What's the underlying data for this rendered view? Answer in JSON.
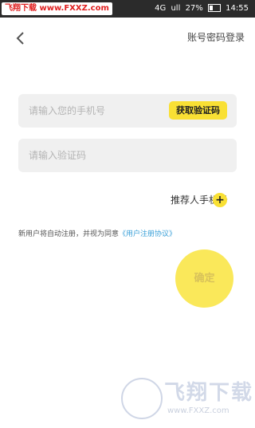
{
  "status_bar": {
    "watermark_text": "飞翔下载 www.FXXZ.com",
    "battery_percent": "27%",
    "time": "14:55",
    "signal_text": "4G",
    "network_text": "ull"
  },
  "header": {
    "back_icon": "chevron-left-icon",
    "title": "账号密码登录"
  },
  "form": {
    "phone_placeholder": "请输入您的手机号",
    "get_code_label": "获取验证码",
    "code_placeholder": "请输入验证码"
  },
  "referrer": {
    "label": "推荐人手机号",
    "add_symbol": "+"
  },
  "agreement": {
    "text": "新用户将自动注册，并视为同意",
    "link": "《用户注册协议》"
  },
  "confirm": {
    "label": "确定"
  },
  "watermark": {
    "brand": "飞翔下载",
    "url": "www.FXXZ.com"
  },
  "colors": {
    "accent": "#f9e034",
    "link": "#3aa0d8",
    "status_bar": "#2b2b2b",
    "field_bg": "#f0f0f0"
  }
}
